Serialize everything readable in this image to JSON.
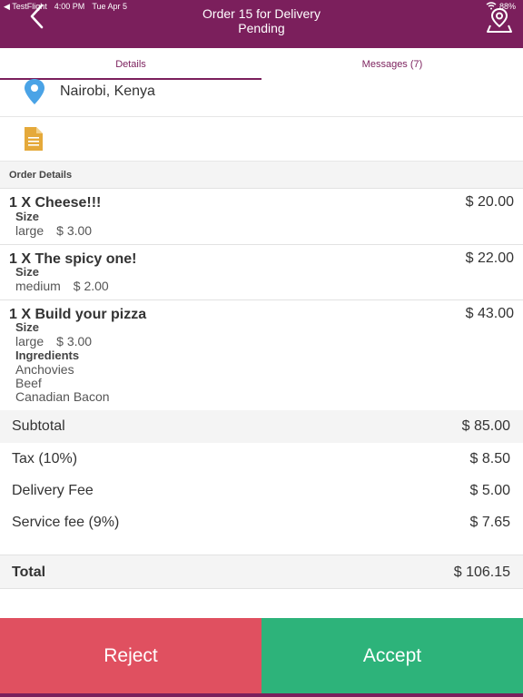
{
  "status_bar": {
    "carrier": "◀ TestFlight",
    "time": "4:00 PM",
    "date": "Tue Apr 5",
    "battery": "88%"
  },
  "header": {
    "title_line1": "Order 15 for Delivery",
    "title_line2": "Pending",
    "back_icon": "chevron-left-icon",
    "map_icon": "map-pin-icon",
    "color": "#7b1f5c"
  },
  "tabs": {
    "details": "Details",
    "messages": "Messages (7)"
  },
  "location": {
    "text": "Nairobi, Kenya"
  },
  "order_details": {
    "heading": "Order Details",
    "items": [
      {
        "name": "1 X Cheese!!!",
        "price": "$ 20.00",
        "options": [
          {
            "label": "Size",
            "values": [
              {
                "name": "large",
                "price": "$ 3.00"
              }
            ]
          }
        ]
      },
      {
        "name": "1 X The spicy one!",
        "price": "$ 22.00",
        "options": [
          {
            "label": "Size",
            "values": [
              {
                "name": "medium",
                "price": "$ 2.00"
              }
            ]
          }
        ]
      },
      {
        "name": "1 X Build your pizza",
        "price": "$ 43.00",
        "options": [
          {
            "label": "Size",
            "values": [
              {
                "name": "large",
                "price": "$ 3.00"
              }
            ]
          },
          {
            "label": "Ingredients",
            "values": [
              {
                "name": "Anchovies"
              },
              {
                "name": "Beef"
              },
              {
                "name": "Canadian Bacon"
              }
            ]
          }
        ]
      }
    ]
  },
  "summary": {
    "subtotal_label": "Subtotal",
    "subtotal": "$ 85.00",
    "tax_label": "Tax (10%)",
    "tax": "$ 8.50",
    "delivery_label": "Delivery Fee",
    "delivery": "$ 5.00",
    "service_label": "Service fee (9%)",
    "service": "$ 7.65",
    "total_label": "Total",
    "total": "$ 106.15"
  },
  "actions": {
    "reject": "Reject",
    "accept": "Accept",
    "reject_color": "#e05060",
    "accept_color": "#2db37a"
  }
}
